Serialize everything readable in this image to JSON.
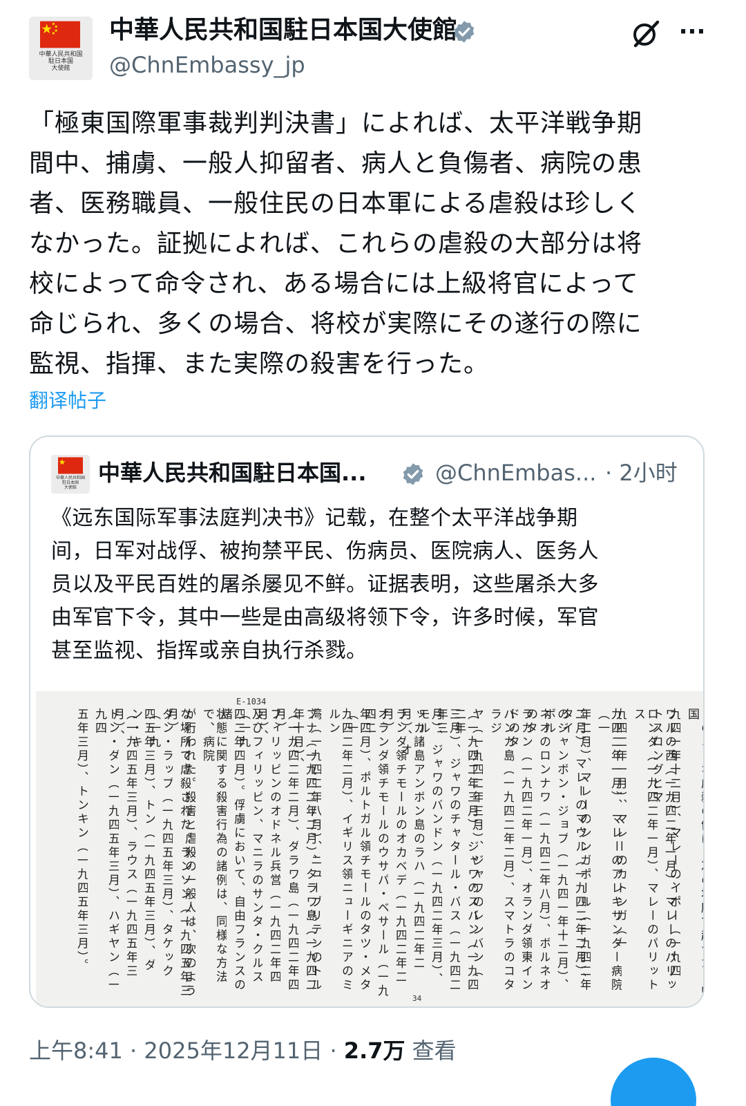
{
  "author": {
    "display_name": "中華人民共和国駐日本国大使館",
    "handle": "@ChnEmbassy_jp",
    "avatar_text": "中華人民共和国\n駐日本国\n大使館"
  },
  "post": {
    "lines": [
      "「極東国際軍事裁判判決書」によれば、太平洋戦争期",
      "間中、捕虜、一般人抑留者、病人と負傷者、病院の患",
      "者、医務職員、一般住民の日本軍による虐殺は珍しく",
      "なかった。証拠によれば、これらの虐殺の大部分は将",
      "校によって命令され、ある場合には上級将官によって",
      "命じられ、多くの場合、将校が実際にその遂行の際に",
      "監視、指揮、また実際の殺害を行った。"
    ],
    "translate_label": "翻译帖子"
  },
  "quote": {
    "display_name": "中華人民共和国駐日本国...",
    "handle": "@ChnEmbas...",
    "time": "· 2小时",
    "lines": [
      "《远东国际军事法庭判决书》记载，在整个太平洋战争期",
      "间，日军对战俘、被拘禁平民、伤病员、医院病人、医务人",
      "员以及平民百姓的屠杀屡见不鲜。证据表明，这些屠杀大多",
      "由军官下令，其中一些是由高级将领下令，许多时候，军官",
      "甚至监视、指挥或亲自执行杀戮。"
    ],
    "image": {
      "page_label": "E-1034",
      "bottom_label": "34",
      "columns": [
        "このような虐殺の例は、次の場所で起つた。中国",
        "九四一年十二月）、マレーのイポー（一九四",
        "ワルの西（一九四二年一月）、マレーのパリットスロングとマ",
        "ロンダ（一九四二年一月）、マレーのパリットス",
        "九四二年一月）、マレーのカトンガ（一",
        "九四二年一月）、マレーのアレキサンダー病院（一",
        "年二月）、マレーのシンガポール（一九四二年",
        "二月）、マレーのマウル（一九四二年二月）、タイ",
        "のジャンボン・ジョプ（一九四一年十二月）、ボル",
        "ネオのロンナワ（一九四二年八月）、ボルネオのタ",
        "ラカン（一九四二年一月）、オランダ領東インドのタ",
        "バンカ島（一九四二年二月）、スマトラのコタラジ",
        "ヤ（一九四二年三月）、ジャワのレンバン（",
        "（一九四二年三月）、ジャワのスバン（一九四二年",
        "三月）、ジャワのチャタール・バス（一九四二年三",
        "月）、ジャワのバンドン（一九四二年三月）、モル",
        "ッカ諸島アンボン島のラハ（一九四二年二月）、オ",
        "ランダ領チモールのオカベデ（一九四二年二月）",
        "オランダ領チモールのウサパ・ベサール（一九四二",
        "年四月）、ポルトガル領チモールのタツ・メタ（一",
        "九四二年二月）、イギリス領ニューギニアのミルン",
        "湾（一九四二年八月）、ニューブリテンのトル",
        "ブナ（一九四二年二月）、タラワ島（一九四二年十月）、",
        "（一九四二年二月）、ダラワ島（一九四二年四月）",
        "フィリッピンのオドネル兵営（一九四二年四月）、",
        "及びフィリッピン、マニラのサンタ・クルス（一九",
        "四二年四月）。俘虜において、自由フランスの諸",
        "状態に関する殺害行為の諸例は、同様な方法で、病院",
        "が行われた。殺害と虐殺の一般人は、次のよう",
        "な場所で虐殺された。ランソン（一九四五年三月）",
        "ダン・ラップ（一九四五年三月）、タケック（一九",
        "四五年三月）、トン（一九四五年三月）、ダン・キ",
        "（一九四五年三月）、ラウス（一九四五年三月）、",
        "ドン・ダン（一九四五年三月）、ハギヤン（一九四",
        "五年三月）、トンキン（一九四五年三月）。"
      ]
    }
  },
  "meta": {
    "time": "上午8:41",
    "sep": " · ",
    "date": "2025年12月11日",
    "sep2": " · ",
    "views": "2.7万",
    "views_label": " 查看"
  },
  "colors": {
    "accent": "#1d9bf0",
    "secondary_text": "#536471",
    "verified_badge": "#829aab",
    "flag_red": "#de2910",
    "flag_star": "#ffde00"
  },
  "icons": {
    "verified": "verified-badge-icon",
    "grok": "grok-icon",
    "more": "more-options-icon",
    "fab": "compose-fab"
  }
}
